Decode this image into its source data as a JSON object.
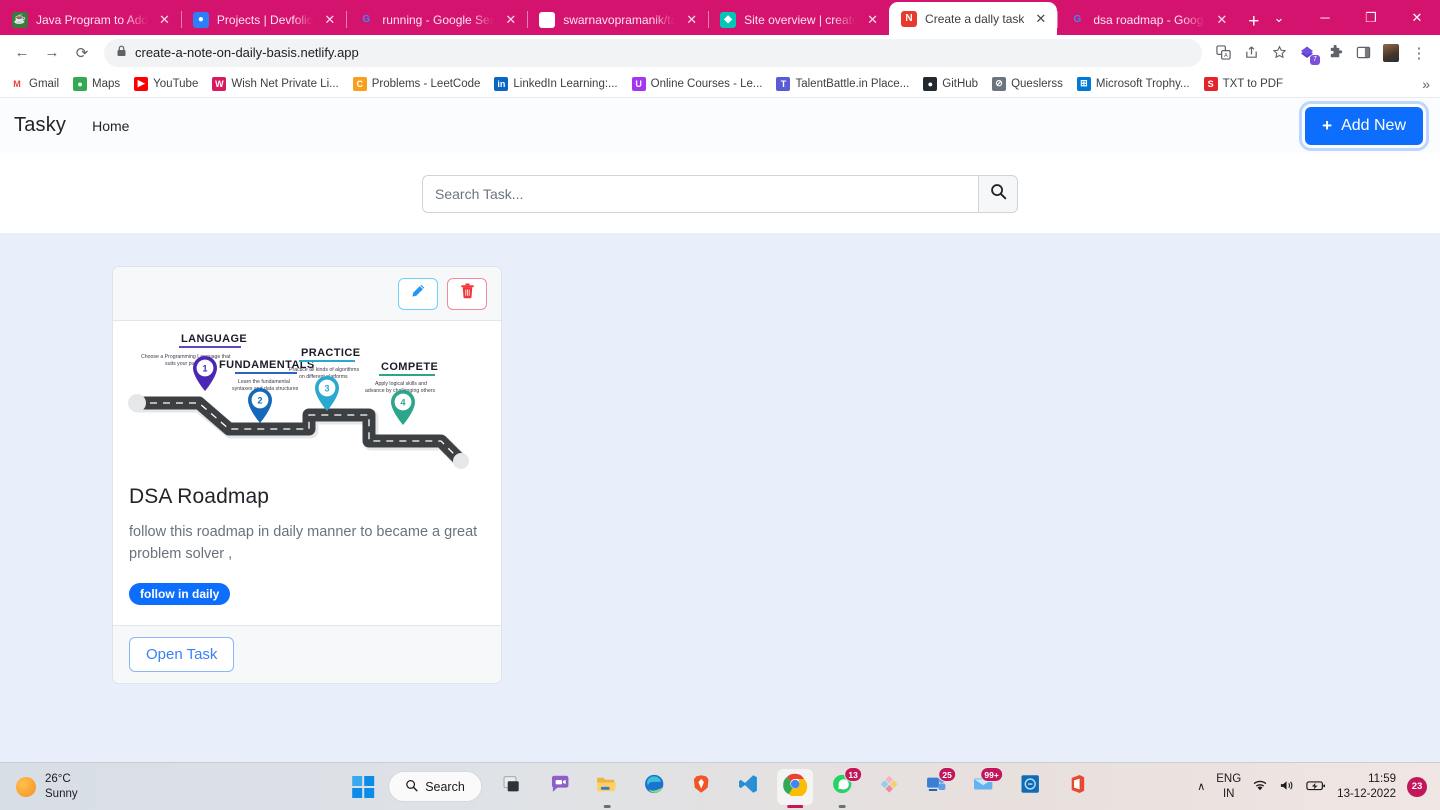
{
  "browser": {
    "tabs": [
      {
        "title": "Java Program to Add",
        "icon": "java-icon",
        "icon_color": "#3b7a3b",
        "icon_glyph": "☕",
        "active": false
      },
      {
        "title": "Projects | Devfolio",
        "icon": "devfolio-icon",
        "icon_color": "#2d7ff9",
        "icon_glyph": "●",
        "active": false
      },
      {
        "title": "running - Google Sea",
        "icon": "google-icon",
        "icon_color": "#ffffff",
        "icon_glyph": "G",
        "active": false
      },
      {
        "title": "swarnavopramanik/ta",
        "icon": "github-icon",
        "icon_color": "#ffffff",
        "icon_glyph": "●",
        "active": false
      },
      {
        "title": "Site overview | create",
        "icon": "netlify-diamond-icon",
        "icon_color": "#00c7b7",
        "icon_glyph": "◆",
        "active": false
      },
      {
        "title": "Create a dally task",
        "icon": "netlify-n-icon",
        "icon_color": "#e8392f",
        "icon_glyph": "N",
        "active": true
      },
      {
        "title": "dsa roadmap - Googl",
        "icon": "google-icon",
        "icon_color": "#ffffff",
        "icon_glyph": "G",
        "active": false
      }
    ],
    "new_tab_label": "+",
    "window_controls": [
      "⌄",
      "─",
      "❐",
      "✕"
    ],
    "nav": {
      "back": "←",
      "forward": "→",
      "reload": "⟳"
    },
    "omnibox": {
      "lock": "🔒",
      "url": "create-a-note-on-daily-basis.netlify.app"
    },
    "toolbar_icons": [
      "translate-icon",
      "share-icon",
      "bookmark-star-icon",
      "extension-purple-icon",
      "extensions-puzzle-icon",
      "side-panel-icon",
      "profile-avatar-icon",
      "chrome-menu-icon"
    ],
    "extension_badge": "7",
    "bookmarks": [
      {
        "label": "Gmail",
        "icon_glyph": "M",
        "color": "#ea4335",
        "bg": "#ffffff"
      },
      {
        "label": "Maps",
        "icon_glyph": "●",
        "color": "#ffffff",
        "bg": "#34a853"
      },
      {
        "label": "YouTube",
        "icon_glyph": "▶",
        "color": "#ffffff",
        "bg": "#ff0000"
      },
      {
        "label": "Wish Net Private Li...",
        "icon_glyph": "W",
        "color": "#ffffff",
        "bg": "#d81b60"
      },
      {
        "label": "Problems - LeetCode",
        "icon_glyph": "C",
        "color": "#ffffff",
        "bg": "#f89f1b"
      },
      {
        "label": "LinkedIn Learning:...",
        "icon_glyph": "in",
        "color": "#ffffff",
        "bg": "#0a66c2"
      },
      {
        "label": "Online Courses - Le...",
        "icon_glyph": "U",
        "color": "#ffffff",
        "bg": "#a435f0"
      },
      {
        "label": "TalentBattle.in Place...",
        "icon_glyph": "T",
        "color": "#ffffff",
        "bg": "#5b5bd6"
      },
      {
        "label": "GitHub",
        "icon_glyph": "●",
        "color": "#ffffff",
        "bg": "#24292f"
      },
      {
        "label": "Queslerss",
        "icon_glyph": "⊘",
        "color": "#ffffff",
        "bg": "#6c757d"
      },
      {
        "label": "Microsoft Trophy...",
        "icon_glyph": "⊞",
        "color": "#ffffff",
        "bg": "#0078d4"
      },
      {
        "label": "TXT to PDF",
        "icon_glyph": "S",
        "color": "#ffffff",
        "bg": "#e3242b"
      }
    ],
    "bookmarks_overflow": "»"
  },
  "app": {
    "navbar": {
      "brand": "Tasky",
      "home_link": "Home",
      "add_new_label": "Add New",
      "add_new_plus": "+",
      "accent_color": "#0d6efd"
    },
    "search": {
      "placeholder": "Search Task...",
      "value": "",
      "button_icon": "search-icon"
    },
    "card": {
      "edit_icon": "pencil-icon",
      "delete_icon": "trash-icon",
      "edit_border_color": "#6fd2f5",
      "delete_border_color": "#f08ba0",
      "title": "DSA Roadmap",
      "description": "follow this roadmap in daily manner to became a great problem solver ,",
      "chip_label": "follow in daily",
      "chip_color": "#0d6efd",
      "open_button_label": "Open Task"
    },
    "roadmap_image": {
      "alt": "dsa-roadmap-infographic",
      "steps": [
        {
          "number": "1",
          "heading": "LANGUAGE",
          "caption": "Choose a Programming Language that suits your purpose",
          "color": "#4b27b5"
        },
        {
          "number": "2",
          "heading": "FUNDAMENTALS",
          "caption": "Learn the fundamental syntaxes and data structures",
          "color": "#1668b8"
        },
        {
          "number": "3",
          "heading": "PRACTICE",
          "caption": "Practice all kinds of algorithms on different platforms",
          "color": "#29a8d0"
        },
        {
          "number": "4",
          "heading": "COMPETE",
          "caption": "Apply logical skills and advance by challenging others",
          "color": "#2da58a"
        }
      ],
      "road_color": "#3d4043"
    }
  },
  "taskbar": {
    "weather": {
      "temp": "26°C",
      "condition": "Sunny",
      "icon": "sun-icon"
    },
    "start_icon": "windows-logo-icon",
    "search_label": "Search",
    "search_icon": "search-icon",
    "apps": [
      {
        "name": "task-view-icon",
        "badge": "",
        "state": ""
      },
      {
        "name": "chat-icon",
        "badge": "",
        "state": ""
      },
      {
        "name": "file-explorer-icon",
        "badge": "",
        "state": "open"
      },
      {
        "name": "edge-icon",
        "badge": "",
        "state": ""
      },
      {
        "name": "brave-icon",
        "badge": "",
        "state": ""
      },
      {
        "name": "vscode-icon",
        "badge": "",
        "state": ""
      },
      {
        "name": "chrome-icon",
        "badge": "",
        "state": "active"
      },
      {
        "name": "whatsapp-icon",
        "badge": "13",
        "state": "open"
      },
      {
        "name": "photos-icon",
        "badge": "",
        "state": ""
      },
      {
        "name": "teams-icon",
        "badge": "25",
        "state": ""
      },
      {
        "name": "mail-icon",
        "badge": "99+",
        "state": ""
      },
      {
        "name": "dell-icon",
        "badge": "",
        "state": ""
      },
      {
        "name": "office-icon",
        "badge": "",
        "state": ""
      }
    ],
    "tray": {
      "chevron": "∧",
      "lang_line1": "ENG",
      "lang_line2": "IN",
      "wifi_icon": "wifi-icon",
      "volume_icon": "volume-icon",
      "battery_icon": "battery-charging-icon",
      "time": "11:59",
      "date": "13-12-2022",
      "notification_count": "23"
    }
  }
}
